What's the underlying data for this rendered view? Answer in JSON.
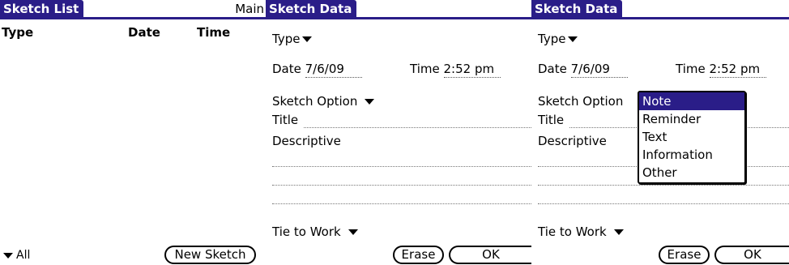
{
  "list_screen": {
    "title": "Sketch List",
    "category": "Main",
    "columns": [
      "Type",
      "Date",
      "Time"
    ],
    "filter_label": "All",
    "new_button": "New Sketch"
  },
  "data_screen": {
    "title": "Sketch Data",
    "type_label": "Type",
    "date_label": "Date",
    "date_value": "7/6/09",
    "time_label": "Time",
    "time_value": "2:52 pm",
    "sketch_option_label": "Sketch Option",
    "title_label": "Title",
    "descriptive_label": "Descriptive",
    "tie_label": "Tie to Work",
    "erase_button": "Erase",
    "ok_button": "OK"
  },
  "dropdown": {
    "options": [
      "Note",
      "Reminder",
      "Text",
      "Information",
      "Other"
    ],
    "selected": "Note"
  }
}
